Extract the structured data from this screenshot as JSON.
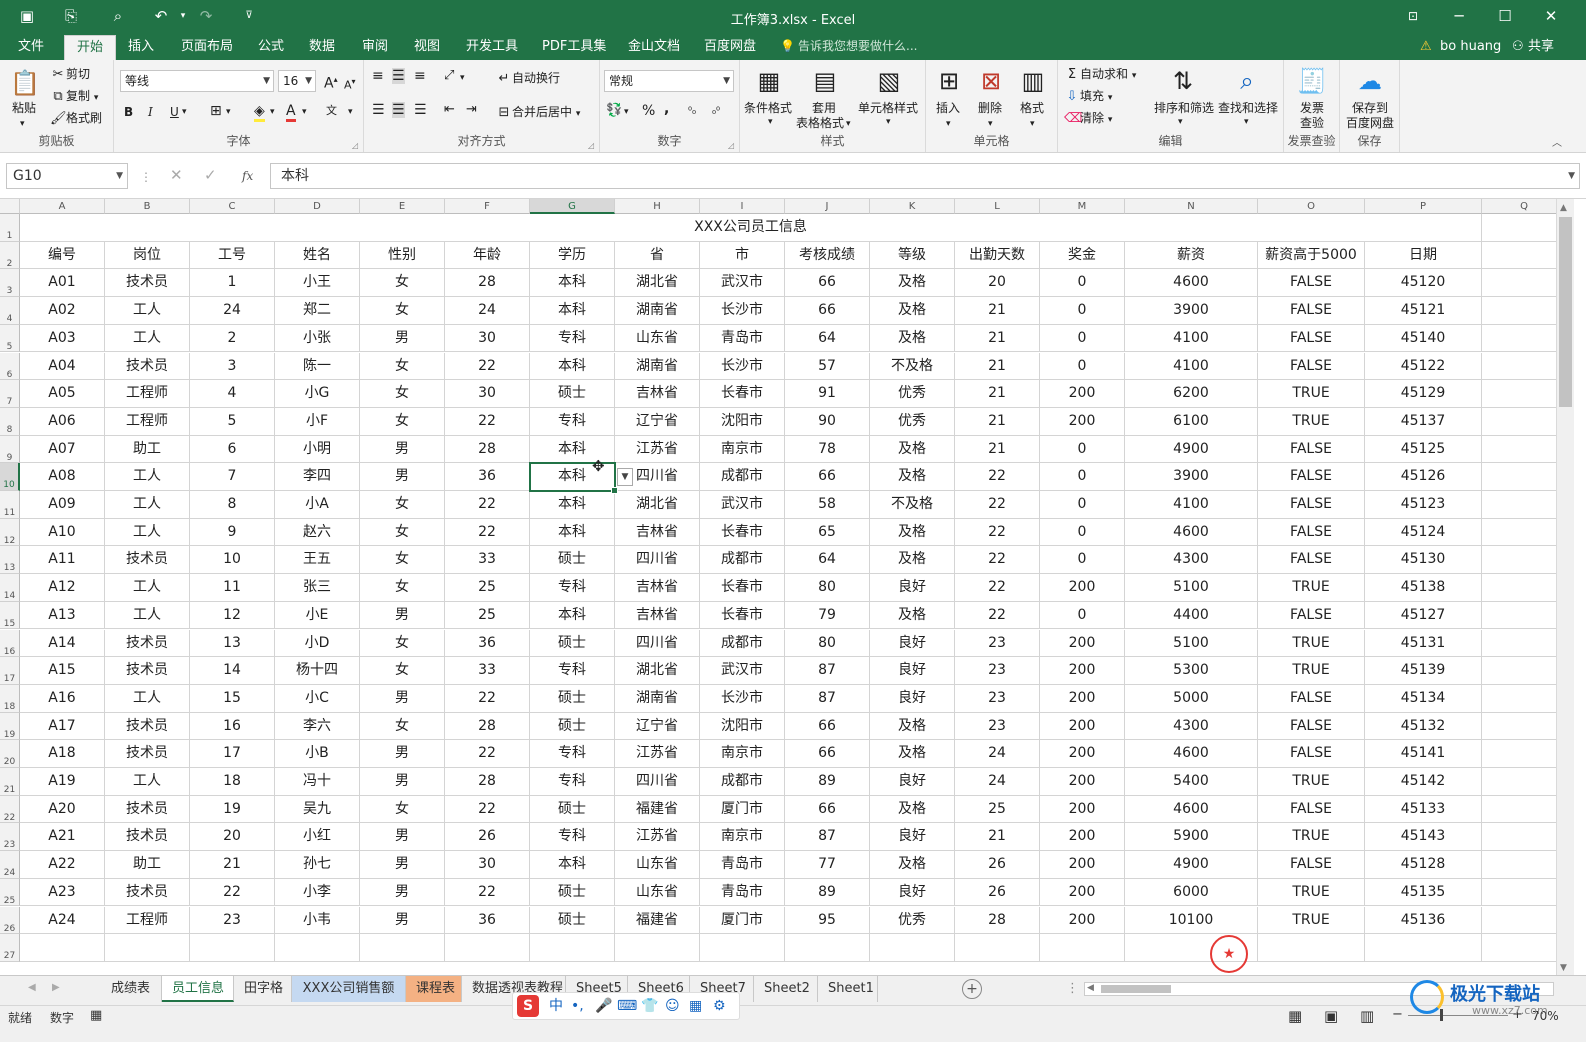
{
  "titlebar": {
    "title": "工作簿3.xlsx - Excel",
    "quick_access": [
      "save-icon",
      "save-as-pdf-icon",
      "print-preview-icon",
      "undo-icon",
      "redo-icon",
      "customize-icon"
    ],
    "controls": [
      "restore-ribbon-icon",
      "minimize-icon",
      "maximize-icon",
      "close-icon"
    ]
  },
  "menu": {
    "tabs": [
      "文件",
      "开始",
      "插入",
      "页面布局",
      "公式",
      "数据",
      "审阅",
      "视图",
      "开发工具",
      "PDF工具集",
      "金山文档",
      "百度网盘"
    ],
    "active": "开始",
    "tell_me": "告诉我您想要做什么...",
    "user": "bo huang",
    "share": "共享"
  },
  "ribbon": {
    "clipboard": {
      "paste": "粘贴",
      "cut": "剪切",
      "copy": "复制",
      "format_painter": "格式刷",
      "label": "剪贴板"
    },
    "font": {
      "name": "等线",
      "size": "16",
      "bold": "B",
      "italic": "I",
      "underline": "U",
      "grow": "A",
      "shrink": "A",
      "label": "字体"
    },
    "alignment": {
      "wrap": "自动换行",
      "merge": "合并后居中",
      "label": "对齐方式"
    },
    "number": {
      "format": "常规",
      "percent": "%",
      "comma": ",",
      "label": "数字"
    },
    "styles": {
      "conditional": "条件格式",
      "table_1": "套用",
      "table_2": "表格格式",
      "cell_styles": "单元格样式",
      "label": "样式"
    },
    "cells": {
      "insert": "插入",
      "delete": "删除",
      "format": "格式",
      "label": "单元格"
    },
    "editing": {
      "autosum": "自动求和",
      "fill": "填充",
      "clear": "清除",
      "sort_filter": "排序和筛选",
      "find_select": "查找和选择",
      "label": "编辑"
    },
    "invoice": {
      "btn1": "发票",
      "btn2": "查验",
      "label": "发票查验"
    },
    "save": {
      "btn1": "保存到",
      "btn2": "百度网盘",
      "label": "保存"
    }
  },
  "formula_bar": {
    "name_box": "G10",
    "fx": "fx",
    "value": "本科"
  },
  "sheet": {
    "columns": [
      "A",
      "B",
      "C",
      "D",
      "E",
      "F",
      "G",
      "H",
      "I",
      "J",
      "K",
      "L",
      "M",
      "N",
      "O",
      "P",
      "Q"
    ],
    "selected_column": "G",
    "selected_row": 10,
    "title": "XXX公司员工信息",
    "headers": [
      "编号",
      "岗位",
      "工号",
      "姓名",
      "性别",
      "年龄",
      "学历",
      "省",
      "市",
      "考核成绩",
      "等级",
      "出勤天数",
      "奖金",
      "薪资",
      "薪资高于5000",
      "日期"
    ],
    "rows": [
      [
        "A01",
        "技术员",
        "1",
        "小王",
        "女",
        "28",
        "本科",
        "湖北省",
        "武汉市",
        "66",
        "及格",
        "20",
        "0",
        "4600",
        "FALSE",
        "45120"
      ],
      [
        "A02",
        "工人",
        "24",
        "郑二",
        "女",
        "24",
        "本科",
        "湖南省",
        "长沙市",
        "66",
        "及格",
        "21",
        "0",
        "3900",
        "FALSE",
        "45121"
      ],
      [
        "A03",
        "工人",
        "2",
        "小张",
        "男",
        "30",
        "专科",
        "山东省",
        "青岛市",
        "64",
        "及格",
        "21",
        "0",
        "4100",
        "FALSE",
        "45140"
      ],
      [
        "A04",
        "技术员",
        "3",
        "陈一",
        "女",
        "22",
        "本科",
        "湖南省",
        "长沙市",
        "57",
        "不及格",
        "21",
        "0",
        "4100",
        "FALSE",
        "45122"
      ],
      [
        "A05",
        "工程师",
        "4",
        "小G",
        "女",
        "30",
        "硕士",
        "吉林省",
        "长春市",
        "91",
        "优秀",
        "21",
        "200",
        "6200",
        "TRUE",
        "45129"
      ],
      [
        "A06",
        "工程师",
        "5",
        "小F",
        "女",
        "22",
        "专科",
        "辽宁省",
        "沈阳市",
        "90",
        "优秀",
        "21",
        "200",
        "6100",
        "TRUE",
        "45137"
      ],
      [
        "A07",
        "助工",
        "6",
        "小明",
        "男",
        "28",
        "本科",
        "江苏省",
        "南京市",
        "78",
        "及格",
        "21",
        "0",
        "4900",
        "FALSE",
        "45125"
      ],
      [
        "A08",
        "工人",
        "7",
        "李四",
        "男",
        "36",
        "本科",
        "四川省",
        "成都市",
        "66",
        "及格",
        "22",
        "0",
        "3900",
        "FALSE",
        "45126"
      ],
      [
        "A09",
        "工人",
        "8",
        "小A",
        "女",
        "22",
        "本科",
        "湖北省",
        "武汉市",
        "58",
        "不及格",
        "22",
        "0",
        "4100",
        "FALSE",
        "45123"
      ],
      [
        "A10",
        "工人",
        "9",
        "赵六",
        "女",
        "22",
        "本科",
        "吉林省",
        "长春市",
        "65",
        "及格",
        "22",
        "0",
        "4600",
        "FALSE",
        "45124"
      ],
      [
        "A11",
        "技术员",
        "10",
        "王五",
        "女",
        "33",
        "硕士",
        "四川省",
        "成都市",
        "64",
        "及格",
        "22",
        "0",
        "4300",
        "FALSE",
        "45130"
      ],
      [
        "A12",
        "工人",
        "11",
        "张三",
        "女",
        "25",
        "专科",
        "吉林省",
        "长春市",
        "80",
        "良好",
        "22",
        "200",
        "5100",
        "TRUE",
        "45138"
      ],
      [
        "A13",
        "工人",
        "12",
        "小E",
        "男",
        "25",
        "本科",
        "吉林省",
        "长春市",
        "79",
        "及格",
        "22",
        "0",
        "4400",
        "FALSE",
        "45127"
      ],
      [
        "A14",
        "技术员",
        "13",
        "小D",
        "女",
        "36",
        "硕士",
        "四川省",
        "成都市",
        "80",
        "良好",
        "23",
        "200",
        "5100",
        "TRUE",
        "45131"
      ],
      [
        "A15",
        "技术员",
        "14",
        "杨十四",
        "女",
        "33",
        "专科",
        "湖北省",
        "武汉市",
        "87",
        "良好",
        "23",
        "200",
        "5300",
        "TRUE",
        "45139"
      ],
      [
        "A16",
        "工人",
        "15",
        "小C",
        "男",
        "22",
        "硕士",
        "湖南省",
        "长沙市",
        "87",
        "良好",
        "23",
        "200",
        "5000",
        "FALSE",
        "45134"
      ],
      [
        "A17",
        "技术员",
        "16",
        "李六",
        "女",
        "28",
        "硕士",
        "辽宁省",
        "沈阳市",
        "66",
        "及格",
        "23",
        "200",
        "4300",
        "FALSE",
        "45132"
      ],
      [
        "A18",
        "技术员",
        "17",
        "小B",
        "男",
        "22",
        "专科",
        "江苏省",
        "南京市",
        "66",
        "及格",
        "24",
        "200",
        "4600",
        "FALSE",
        "45141"
      ],
      [
        "A19",
        "工人",
        "18",
        "冯十",
        "男",
        "28",
        "专科",
        "四川省",
        "成都市",
        "89",
        "良好",
        "24",
        "200",
        "5400",
        "TRUE",
        "45142"
      ],
      [
        "A20",
        "技术员",
        "19",
        "吴九",
        "女",
        "22",
        "硕士",
        "福建省",
        "厦门市",
        "66",
        "及格",
        "25",
        "200",
        "4600",
        "FALSE",
        "45133"
      ],
      [
        "A21",
        "技术员",
        "20",
        "小红",
        "男",
        "26",
        "专科",
        "江苏省",
        "南京市",
        "87",
        "良好",
        "21",
        "200",
        "5900",
        "TRUE",
        "45143"
      ],
      [
        "A22",
        "助工",
        "21",
        "孙七",
        "男",
        "30",
        "本科",
        "山东省",
        "青岛市",
        "77",
        "及格",
        "26",
        "200",
        "4900",
        "FALSE",
        "45128"
      ],
      [
        "A23",
        "技术员",
        "22",
        "小李",
        "男",
        "22",
        "硕士",
        "山东省",
        "青岛市",
        "89",
        "良好",
        "26",
        "200",
        "6000",
        "TRUE",
        "45135"
      ],
      [
        "A24",
        "工程师",
        "23",
        "小韦",
        "男",
        "36",
        "硕士",
        "福建省",
        "厦门市",
        "95",
        "优秀",
        "28",
        "200",
        "10100",
        "TRUE",
        "45136"
      ]
    ]
  },
  "sheet_tabs": {
    "tabs": [
      "成绩表",
      "员工信息",
      "田字格",
      "XXX公司销售额",
      "课程表",
      "数据透视表教程",
      "Sheet5",
      "Sheet6",
      "Sheet7",
      "Sheet2",
      "Sheet1"
    ],
    "active": "员工信息",
    "tab_colors": {
      "XXX公司销售额": "#c5d9f1",
      "课程表": "#f4b183"
    }
  },
  "status": {
    "ready": "就绪",
    "mode": "数字",
    "zoom": "70%"
  },
  "ime": {
    "logo": "S",
    "lang": "中"
  },
  "watermark": {
    "brand": "极光下载站",
    "url": "www.xz7.com"
  },
  "colors": {
    "accent": "#217346",
    "stamp": "#e53935"
  }
}
